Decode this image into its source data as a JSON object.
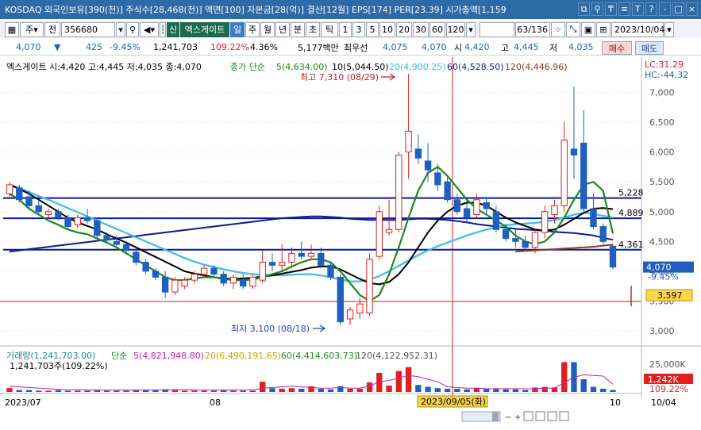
{
  "window": {
    "title": "KOSDAQ 외국인보유[390(천)] 주식수[28,468(천)] 액면[100] 자본금[28(억)] 결산[12월] EPS[174] PER[23.39] 시가총액[1,159",
    "buttons": [
      "⧉",
      "⚲",
      "₸",
      "≡",
      "T",
      "?",
      "-",
      "□",
      "×"
    ]
  },
  "toolbar": {
    "market": "주",
    "market2": "전",
    "code": "356680",
    "sin_badge": "신",
    "stock_name": "엑스게이트",
    "periods": [
      "일",
      "주",
      "월",
      "년",
      "분",
      "초",
      "틱"
    ],
    "active_period": "일",
    "intervals": [
      "1",
      "3",
      "5",
      "10",
      "20",
      "30",
      "60",
      "120"
    ],
    "count": "63",
    "count_total": "/136",
    "date": "2023/10/04"
  },
  "quote": {
    "price": "4,070",
    "arrow": "▼",
    "change": "425",
    "change_pct": "-9.45%",
    "volume": "1,241,703",
    "vol_ratio": "109.22%",
    "turnover": "4.36%",
    "amount": "5,177백만",
    "best_label": "최우선",
    "best_price1": "4,075",
    "best_price2": "4,070",
    "open_label": "시",
    "open": "4,420",
    "high_label": "고",
    "high": "4,445",
    "low_label": "저",
    "low": "4,035",
    "buy": "매수",
    "sell": "매도"
  },
  "legend": {
    "name": "엑스게이트 시:4,420 고:4,445 저:4,035 종:4,070",
    "close_label": "종가 단순",
    "ma5": "5(4,634.00)",
    "ma10": "10(5,044.50)",
    "ma20": "20(4,900.25)",
    "ma60": "60(4,528.50)",
    "ma120": "120(4,446.96)",
    "lc": "LC:31.29",
    "hc": "HC:-44.32"
  },
  "annotations": {
    "high": "최고 7,310 (08/29)",
    "low": "최저 3,100 (08/18)"
  },
  "price_axis": {
    "ticks": [
      "7,000",
      "6,500",
      "6,000",
      "5,500",
      "5,000",
      "4,500",
      "4,000",
      "3,500",
      "3,000"
    ],
    "current": "4,070",
    "current_pct": "-9.45%",
    "marker": "3,597"
  },
  "hlines": [
    "5,228",
    "4,889",
    "4,361"
  ],
  "volume_legend": {
    "main": "거래량(1,241,703.00)",
    "close_label": "단순",
    "ma5": "5(4,821,948.80)",
    "ma20": "20(6,490,191.65)",
    "ma60": "60(4,414,603.73)",
    "ma120": "120(4,122,952.31)",
    "sub": "1,241,703주(109.22%)",
    "axis_tick": "25,000K",
    "current": "1,242K",
    "current_pct": "109.22%"
  },
  "date_axis": {
    "labels": [
      "2023/07",
      "08",
      "10",
      "10/04"
    ],
    "cursor": "2023/09/05(화)"
  },
  "colors": {
    "up": "#e02020",
    "down": "#1f5fbf",
    "ma5": "#1a8a1a",
    "ma10": "#000000",
    "ma20": "#3bbcec",
    "ma60": "#101a8c",
    "ma120": "#8b3a1a",
    "hline": "#0a1aa8"
  },
  "chart_data": {
    "type": "candlestick",
    "ylim": [
      2800,
      7300
    ],
    "candles": [
      {
        "o": 5300,
        "h": 5500,
        "l": 5250,
        "c": 5450
      },
      {
        "o": 5400,
        "h": 5450,
        "l": 5150,
        "c": 5200
      },
      {
        "o": 5250,
        "h": 5350,
        "l": 5050,
        "c": 5100
      },
      {
        "o": 5100,
        "h": 5200,
        "l": 4950,
        "c": 5000
      },
      {
        "o": 4950,
        "h": 5050,
        "l": 4900,
        "c": 5000
      },
      {
        "o": 5000,
        "h": 5050,
        "l": 4850,
        "c": 4900
      },
      {
        "o": 4900,
        "h": 4950,
        "l": 4700,
        "c": 4750
      },
      {
        "o": 4780,
        "h": 4950,
        "l": 4720,
        "c": 4900
      },
      {
        "o": 4900,
        "h": 5050,
        "l": 4800,
        "c": 4850
      },
      {
        "o": 4850,
        "h": 4900,
        "l": 4550,
        "c": 4600
      },
      {
        "o": 4600,
        "h": 4650,
        "l": 4480,
        "c": 4520
      },
      {
        "o": 4500,
        "h": 4600,
        "l": 4400,
        "c": 4450
      },
      {
        "o": 4450,
        "h": 4500,
        "l": 4300,
        "c": 4350
      },
      {
        "o": 4320,
        "h": 4400,
        "l": 4100,
        "c": 4150
      },
      {
        "o": 4150,
        "h": 4200,
        "l": 3950,
        "c": 4000
      },
      {
        "o": 4000,
        "h": 4050,
        "l": 3850,
        "c": 3900
      },
      {
        "o": 3900,
        "h": 4000,
        "l": 3550,
        "c": 3650
      },
      {
        "o": 3650,
        "h": 3900,
        "l": 3600,
        "c": 3850
      },
      {
        "o": 3750,
        "h": 3900,
        "l": 3700,
        "c": 3850
      },
      {
        "o": 3850,
        "h": 4000,
        "l": 3800,
        "c": 3950
      },
      {
        "o": 3950,
        "h": 4100,
        "l": 3900,
        "c": 4050
      },
      {
        "o": 4050,
        "h": 4100,
        "l": 3900,
        "c": 3950
      },
      {
        "o": 3950,
        "h": 4000,
        "l": 3750,
        "c": 3800
      },
      {
        "o": 3800,
        "h": 3950,
        "l": 3700,
        "c": 3900
      },
      {
        "o": 3850,
        "h": 3950,
        "l": 3700,
        "c": 3750
      },
      {
        "o": 3750,
        "h": 3950,
        "l": 3700,
        "c": 3900
      },
      {
        "o": 3850,
        "h": 4350,
        "l": 3800,
        "c": 4150
      },
      {
        "o": 4150,
        "h": 4300,
        "l": 4000,
        "c": 4100
      },
      {
        "o": 4100,
        "h": 4450,
        "l": 4000,
        "c": 4150
      },
      {
        "o": 4150,
        "h": 4400,
        "l": 4050,
        "c": 4300
      },
      {
        "o": 4300,
        "h": 4500,
        "l": 4200,
        "c": 4250
      },
      {
        "o": 4250,
        "h": 4450,
        "l": 4200,
        "c": 4300
      },
      {
        "o": 4300,
        "h": 4400,
        "l": 4050,
        "c": 4100
      },
      {
        "o": 4100,
        "h": 4150,
        "l": 3850,
        "c": 3900
      },
      {
        "o": 3900,
        "h": 3950,
        "l": 3100,
        "c": 3150
      },
      {
        "o": 3200,
        "h": 3400,
        "l": 3100,
        "c": 3350
      },
      {
        "o": 3300,
        "h": 3550,
        "l": 3200,
        "c": 3450
      },
      {
        "o": 3300,
        "h": 4300,
        "l": 3250,
        "c": 4200
      },
      {
        "o": 4250,
        "h": 5100,
        "l": 4200,
        "c": 5000
      },
      {
        "o": 4650,
        "h": 5200,
        "l": 4600,
        "c": 4700
      },
      {
        "o": 4700,
        "h": 6000,
        "l": 4650,
        "c": 5950
      },
      {
        "o": 6000,
        "h": 7310,
        "l": 5550,
        "c": 6350
      },
      {
        "o": 6050,
        "h": 6300,
        "l": 5800,
        "c": 5900
      },
      {
        "o": 5850,
        "h": 6150,
        "l": 5500,
        "c": 5700
      },
      {
        "o": 5650,
        "h": 5800,
        "l": 5350,
        "c": 5450
      },
      {
        "o": 5500,
        "h": 5600,
        "l": 5150,
        "c": 5200
      },
      {
        "o": 5200,
        "h": 5300,
        "l": 4950,
        "c": 5000
      },
      {
        "o": 5050,
        "h": 5250,
        "l": 4800,
        "c": 4900
      },
      {
        "o": 4950,
        "h": 5300,
        "l": 4900,
        "c": 5200
      },
      {
        "o": 5150,
        "h": 5250,
        "l": 4950,
        "c": 5050
      },
      {
        "o": 5000,
        "h": 5100,
        "l": 4650,
        "c": 4700
      },
      {
        "o": 4700,
        "h": 4800,
        "l": 4500,
        "c": 4550
      },
      {
        "o": 4550,
        "h": 4700,
        "l": 4400,
        "c": 4500
      },
      {
        "o": 4500,
        "h": 4600,
        "l": 4350,
        "c": 4400
      },
      {
        "o": 4400,
        "h": 4700,
        "l": 4300,
        "c": 4650
      },
      {
        "o": 4650,
        "h": 5100,
        "l": 4550,
        "c": 5000
      },
      {
        "o": 4950,
        "h": 5200,
        "l": 4800,
        "c": 5100
      },
      {
        "o": 5100,
        "h": 6500,
        "l": 5000,
        "c": 6200
      },
      {
        "o": 6050,
        "h": 7100,
        "l": 5550,
        "c": 5950
      },
      {
        "o": 6150,
        "h": 6700,
        "l": 4950,
        "c": 5050
      },
      {
        "o": 5050,
        "h": 5300,
        "l": 4700,
        "c": 4750
      },
      {
        "o": 4750,
        "h": 4800,
        "l": 4450,
        "c": 4500
      },
      {
        "o": 4420,
        "h": 4445,
        "l": 4035,
        "c": 4070
      }
    ],
    "ma5": [
      5300,
      5200,
      5050,
      4950,
      4850,
      4780,
      4700,
      4650,
      4620,
      4550,
      4480,
      4400,
      4300,
      4200,
      4100,
      4000,
      3900,
      3850,
      3850,
      3880,
      3900,
      3900,
      3870,
      3850,
      3850,
      3860,
      3900,
      3950,
      4000,
      4080,
      4150,
      4200,
      4200,
      4150,
      4000,
      3800,
      3600,
      3500,
      3600,
      3950,
      4400,
      4900,
      5350,
      5650,
      5750,
      5600,
      5400,
      5200,
      5050,
      4950,
      4850,
      4750,
      4600,
      4500,
      4450,
      4500,
      4650,
      4900,
      5200,
      5450,
      5500,
      5350,
      4634
    ],
    "ma10": [
      5450,
      5380,
      5300,
      5200,
      5100,
      5000,
      4900,
      4820,
      4760,
      4700,
      4620,
      4550,
      4480,
      4400,
      4320,
      4240,
      4160,
      4080,
      4000,
      3960,
      3930,
      3900,
      3880,
      3870,
      3880,
      3890,
      3910,
      3930,
      3960,
      3990,
      4020,
      4060,
      4080,
      4080,
      4030,
      3950,
      3870,
      3800,
      3780,
      3820,
      3950,
      4150,
      4400,
      4650,
      4850,
      5000,
      5100,
      5150,
      5150,
      5100,
      5000,
      4900,
      4820,
      4760,
      4700,
      4680,
      4700,
      4780,
      4880,
      4980,
      5050,
      5060,
      5044
    ],
    "ma20": [
      5450,
      5400,
      5330,
      5260,
      5200,
      5130,
      5060,
      4990,
      4920,
      4850,
      4780,
      4710,
      4640,
      4570,
      4500,
      4430,
      4360,
      4290,
      4220,
      4160,
      4110,
      4070,
      4030,
      4000,
      3970,
      3950,
      3940,
      3930,
      3930,
      3940,
      3950,
      3950,
      3930,
      3900,
      3860,
      3830,
      3830,
      3860,
      3920,
      4000,
      4090,
      4180,
      4270,
      4350,
      4420,
      4480,
      4540,
      4600,
      4650,
      4700,
      4740,
      4770,
      4790,
      4800,
      4810,
      4830,
      4860,
      4900,
      4950,
      4980,
      4960,
      4930,
      4900
    ],
    "ma60": [
      4330,
      4350,
      4370,
      4390,
      4410,
      4430,
      4450,
      4470,
      4490,
      4510,
      4530,
      4550,
      4570,
      4590,
      4610,
      4630,
      4650,
      4670,
      4690,
      4710,
      4730,
      4750,
      4770,
      4790,
      4810,
      4830,
      4850,
      4870,
      4890,
      4900,
      4910,
      4920,
      4920,
      4910,
      4900,
      4880,
      4870,
      4860,
      4860,
      4860,
      4860,
      4870,
      4880,
      4880,
      4870,
      4860,
      4840,
      4820,
      4790,
      4770,
      4750,
      4730,
      4710,
      4700,
      4690,
      4680,
      4660,
      4650,
      4640,
      4620,
      4600,
      4560,
      4528
    ],
    "ma120": [
      null,
      null,
      null,
      null,
      null,
      null,
      null,
      null,
      null,
      null,
      null,
      null,
      null,
      null,
      null,
      null,
      null,
      null,
      null,
      null,
      null,
      null,
      null,
      null,
      null,
      null,
      null,
      null,
      null,
      null,
      null,
      null,
      null,
      null,
      null,
      null,
      null,
      null,
      null,
      null,
      null,
      null,
      null,
      null,
      null,
      null,
      null,
      null,
      null,
      null,
      null,
      null,
      4330,
      4340,
      4350,
      4360,
      4370,
      4380,
      4390,
      4400,
      4410,
      4430,
      4446
    ],
    "volume": [
      0.6,
      0.3,
      0.3,
      0.2,
      0.2,
      0.3,
      0.2,
      0.2,
      0.2,
      0.3,
      0.2,
      0.2,
      0.2,
      0.3,
      0.3,
      0.3,
      0.4,
      0.3,
      0.2,
      0.2,
      0.2,
      0.2,
      0.3,
      0.2,
      0.2,
      0.2,
      1.6,
      0.6,
      0.5,
      0.6,
      0.5,
      0.9,
      0.5,
      0.4,
      0.9,
      0.5,
      0.5,
      1.5,
      3.0,
      1.0,
      3.3,
      3.9,
      1.1,
      0.8,
      0.6,
      0.5,
      0.5,
      0.4,
      0.6,
      0.5,
      0.5,
      0.4,
      0.4,
      0.3,
      0.7,
      0.8,
      0.7,
      4.7,
      4.7,
      2.0,
      0.8,
      0.5,
      0.3
    ],
    "volume_ma5": [
      0.9,
      0.8,
      0.7,
      0.6,
      0.5,
      0.4,
      0.35,
      0.35,
      0.3,
      0.3,
      0.3,
      0.3,
      0.3,
      0.3,
      0.3,
      0.3,
      0.35,
      0.35,
      0.35,
      0.3,
      0.3,
      0.3,
      0.3,
      0.3,
      0.3,
      0.3,
      0.6,
      0.7,
      0.8,
      0.9,
      0.8,
      0.7,
      0.6,
      0.6,
      0.7,
      0.6,
      0.6,
      0.9,
      1.6,
      1.8,
      2.2,
      2.6,
      2.4,
      2.0,
      1.6,
      0.8,
      0.7,
      0.6,
      0.6,
      0.5,
      0.5,
      0.5,
      0.5,
      0.5,
      0.5,
      0.6,
      0.6,
      1.5,
      2.3,
      2.7,
      2.6,
      2.5,
      1.2
    ]
  }
}
